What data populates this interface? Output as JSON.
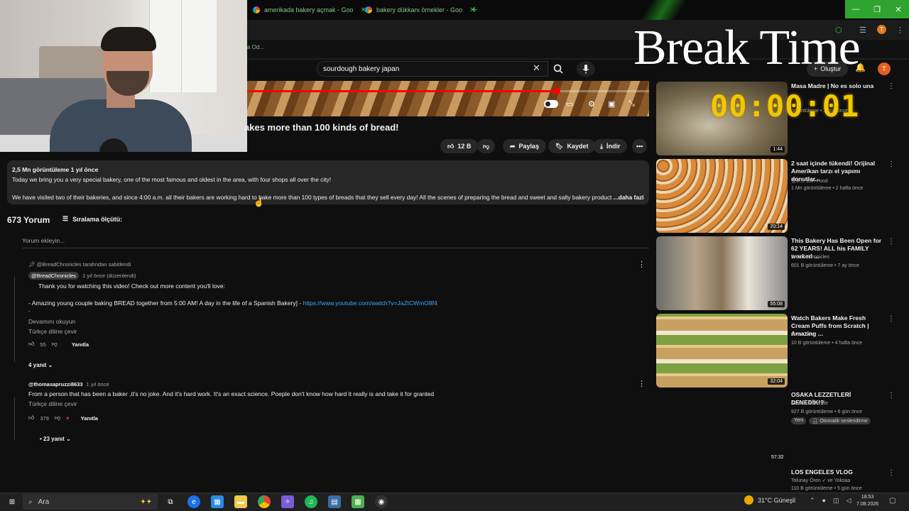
{
  "browser": {
    "tabs": [
      {
        "label": "amerikada bakery açmak - Goo"
      },
      {
        "label": "bakery dükkanı örnekler - Goo"
      }
    ],
    "bookmark_text": "a Od...",
    "profile_initial": "T"
  },
  "overlay": {
    "break_title": "Break Time",
    "timer": "00:00:01"
  },
  "youtube": {
    "search_query": "sourdough bakery japan",
    "create_label": "Oluştur",
    "avatar_initial": "T",
    "video": {
      "progress_fraction": 0.77,
      "title": "akes more than 100 kinds of bread!",
      "likes": "12 B",
      "share_label": "Paylaş",
      "save_label": "Kaydet",
      "download_label": "İndir"
    },
    "description": {
      "meta": "2,5 Mn görüntüleme  1 yıl önce",
      "line1": "Today we bring you a very special bakery, one of the most famous and oldest in the area, with four shops all over the city!",
      "line2": "We have visited two of their bakeries, and since 4:00 a.m. all their bakers are working hard to bake more than 100 types of breads that they sell every day! All the scenes of preparing the bread and sweet and salty bakery product",
      "more": "...daha fazla"
    },
    "comments": {
      "count": "673 Yorum",
      "sort_label": "Sıralama ölçütü:",
      "add_placeholder": "Yorum ekleyin...",
      "pinned": {
        "pinned_by": "@BreadChronicles tarafından sabitlendi",
        "author": "@BreadChronicles",
        "time": "1 yıl önce (düzenlendi)",
        "text1": "Thank you for watching this video! Check out more content you'll love:",
        "text2": "- Amazing young couple baking BREAD together from 5:00 AM! A day in the life of a Spanish Bakery] - ",
        "link": "https://www.youtube.com/watch?v=JaZtCWmO8f4",
        "dash": "-",
        "read_more": "Devamını okuyun",
        "translate": "Türkçe diline çevir",
        "likes": "55",
        "reply": "Yanıtla",
        "replies": "4 yanıt"
      },
      "second": {
        "author": "@thomasapruzzi8633",
        "time": "1 yıl önce",
        "text": "From a person that has been a baker ,it's no joke. And it's hard work. It's an exact science. Poeple don't know how hard it really is and take it for granted",
        "translate": "Türkçe diline çevir",
        "likes": "379",
        "reply": "Yanıtla",
        "replies": "• 23 yanıt"
      }
    },
    "related": [
      {
        "title": "Masa Madre | No es solo una",
        "title2": "...",
        "channel": "",
        "meta": "görüntüleme • 1 gün önce",
        "duration": "1:44"
      },
      {
        "title": "2 saat içinde tükendi! Orijinal Amerikan tarzı el yapımı donutlar...",
        "channel": "빵푸드 JJin Food",
        "meta": "1 Mn görüntüleme • 2 hafta önce",
        "duration": "20:14"
      },
      {
        "title": "This Bakery Has Been Open for 62 YEARS! ALL his FAMILY worked ...",
        "channel": "Bread Chronicles",
        "meta": "601 B görüntüleme • 7 ay önce",
        "duration": "55:08"
      },
      {
        "title": "Watch Bakers Make Fresh Cream Puffs from Scratch | Amazing ...",
        "channel": "Oven Tales",
        "meta": "10 B görüntüleme • 4 hafta önce",
        "duration": "32:04"
      },
      {
        "title": "OSAKA LEZZETLERİ DENEDİK!?",
        "channel": "Atakan & Cemile",
        "meta": "927 B görüntüleme • 6 gün önce",
        "badge1": "Yeni",
        "badge2": "Otomatik seslendirme",
        "duration": "57:32"
      },
      {
        "title": "LOS ENGELES VLOG",
        "channel": "Tolunay Ören ✓ ve Yoksaa",
        "meta": "110 B görüntüleme • 5 gün önce"
      }
    ]
  },
  "taskbar": {
    "search_label": "Ara",
    "weather": "31°C  Güneşli",
    "time": "18:53",
    "date": "7.08.2026"
  }
}
